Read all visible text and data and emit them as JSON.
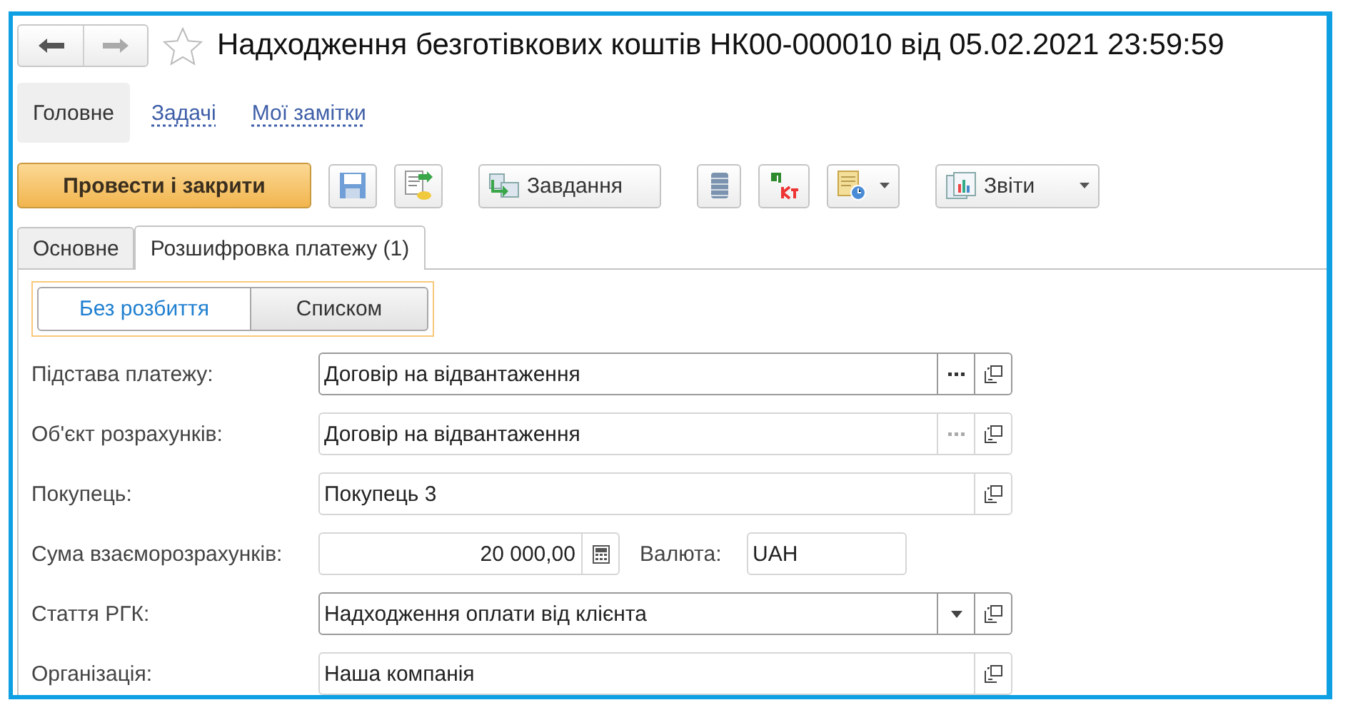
{
  "window": {
    "title": "Надходження безготівкових коштів НК00-000010 від 05.02.2021 23:59:59",
    "favorite": false
  },
  "nav_tabs": [
    {
      "label": "Головне",
      "selected": true
    },
    {
      "label": "Задачі",
      "selected": false
    },
    {
      "label": "Мої замітки",
      "selected": false
    }
  ],
  "toolbar": [
    {
      "kind": "primary",
      "label": "Провести і закрити"
    },
    {
      "kind": "save"
    },
    {
      "kind": "post"
    },
    {
      "kind": "task",
      "label": "Завдання"
    },
    {
      "kind": "list"
    },
    {
      "kind": "dtkt"
    },
    {
      "kind": "schedule",
      "menu": true
    },
    {
      "kind": "reports",
      "label": "Звіти",
      "menu": true
    }
  ],
  "tabs": [
    {
      "label": "Основне",
      "selected": false
    },
    {
      "label": "Розшифровка платежу (1)",
      "selected": true
    }
  ],
  "mode_switch": [
    {
      "label": "Без розбиття",
      "selected": true
    },
    {
      "label": "Списком",
      "selected": false
    }
  ],
  "fields": [
    {
      "label": "Підстава платежу:",
      "value": "Договір на відвантаження",
      "editable": true,
      "buttons": [
        {
          "kind": "choose"
        },
        {
          "kind": "open"
        }
      ]
    },
    {
      "label": "Об'єкт розрахунків:",
      "value": "Договір на відвантаження",
      "editable": false,
      "buttons": [
        {
          "kind": "choose"
        },
        {
          "kind": "open"
        }
      ]
    },
    {
      "label": "Покупець:",
      "value": "Покупець 3",
      "editable": false,
      "buttons": [
        {
          "kind": "open"
        }
      ]
    },
    {
      "label": "Сума взаєморозрахунків:",
      "value": "20 000,00",
      "editable": false,
      "kind": "amount",
      "buttons": [
        {
          "kind": "calculator"
        }
      ],
      "extra": {
        "label": "Валюта:",
        "value": "UAH"
      }
    },
    {
      "label": "Стаття РГК:",
      "value": "Надходження оплати від клієнта",
      "editable": true,
      "buttons": [
        {
          "kind": "dropdown"
        },
        {
          "kind": "open"
        }
      ]
    },
    {
      "label": "Організація:",
      "value": "Наша компанія",
      "editable": false,
      "buttons": [
        {
          "kind": "open"
        }
      ]
    }
  ]
}
